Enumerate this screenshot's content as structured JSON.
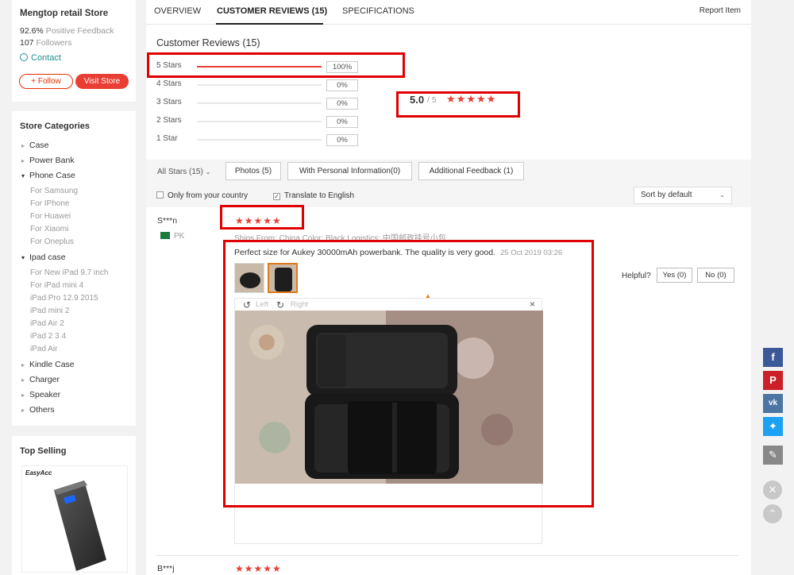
{
  "store": {
    "name": "Mengtop retail Store",
    "feedback_value": "92.6%",
    "feedback_label": "Positive Feedback",
    "followers_value": "107",
    "followers_label": "Followers",
    "contact": "Contact",
    "follow_btn": "+ Follow",
    "visit_btn": "Visit Store"
  },
  "categories": {
    "title": "Store Categories",
    "items": [
      {
        "label": "Case"
      },
      {
        "label": "Power Bank"
      },
      {
        "label": "Phone Case"
      },
      {
        "label": "Ipad case"
      },
      {
        "label": "Kindle Case"
      },
      {
        "label": "Charger"
      },
      {
        "label": "Speaker"
      },
      {
        "label": "Others"
      }
    ],
    "phone_sub": [
      "For Samsung",
      "For IPhone",
      "For Huawei",
      "For Xiaomi",
      "For Oneplus"
    ],
    "ipad_sub": [
      "For New iPad 9.7 inch",
      "For iPad mini 4",
      "iPad Pro 12.9 2015",
      "iPad mini 2",
      "iPad Air 2",
      "iPad 2 3 4",
      "iPad Air"
    ]
  },
  "top_selling": {
    "title": "Top Selling",
    "brand": "EasyAcc"
  },
  "tabs": {
    "overview": "OVERVIEW",
    "reviews": "CUSTOMER REVIEWS (15)",
    "specs": "SPECIFICATIONS",
    "report": "Report Item"
  },
  "reviews_summary": {
    "title": "Customer Reviews (15)",
    "rows": [
      {
        "label": "5 Stars",
        "pct": "100%",
        "fraction": 1.0
      },
      {
        "label": "4 Stars",
        "pct": "0%",
        "fraction": 0
      },
      {
        "label": "3 Stars",
        "pct": "0%",
        "fraction": 0
      },
      {
        "label": "2 Stars",
        "pct": "0%",
        "fraction": 0
      },
      {
        "label": "1 Star",
        "pct": "0%",
        "fraction": 0
      }
    ],
    "average": "5.0",
    "out_of": "/ 5",
    "rating_stars": 5
  },
  "filters": {
    "all_stars": "All Stars (15)",
    "photos": "Photos (5)",
    "personal": "With Personal Information(0)",
    "additional": "Additional Feedback (1)",
    "only_country": "Only from your country",
    "translate": "Translate to English",
    "sort": "Sort by default"
  },
  "review1": {
    "user": "S***n",
    "country": "PK",
    "ships": "Ships From: China    Color: Black    Logistics: 中国邮政挂号小包",
    "text": "Perfect size for Aukey 30000mAh powerbank. The quality is very good.",
    "date": "25 Oct 2019 03:26",
    "helpful": "Helpful?",
    "yes": "Yes (0)",
    "no": "No (0)",
    "rotate_left": "Left",
    "rotate_right": "Right",
    "close": "×",
    "rating_stars": 5
  },
  "review2": {
    "user": "B***j",
    "rating_stars": 5
  },
  "colors": {
    "accent": "#e83e33",
    "annotation": "#e00000",
    "facebook": "#3b5998",
    "pinterest": "#cb2027",
    "vk": "#4c75a3",
    "twitter": "#1da1f2",
    "edit": "#888888"
  },
  "share_icons": [
    "facebook-icon",
    "pinterest-icon",
    "vk-icon",
    "twitter-icon",
    "edit-icon",
    "close-icon",
    "chevron-up-icon"
  ]
}
